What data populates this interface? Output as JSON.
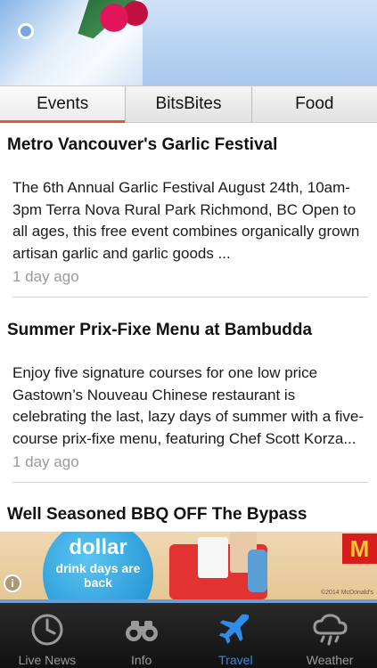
{
  "tabs": [
    {
      "label": "Events",
      "active": true
    },
    {
      "label": "BitsBites",
      "active": false
    },
    {
      "label": "Food",
      "active": false
    }
  ],
  "articles": [
    {
      "title": "Metro Vancouver's Garlic Festival",
      "body": "The 6th Annual Garlic Festival August 24th, 10am-3pm Terra Nova Rural Park Richmond, BC Open to all ages, this free event combines organically grown artisan garlic and garlic goods ...",
      "time": "1 day ago"
    },
    {
      "title": "Summer Prix-Fixe Menu at Bambudda",
      "body": "Enjoy five signature courses for one low price Gastown’s Nouveau Chinese restaurant is celebrating the last, lazy days of summer with a five-course prix-fixe menu, featuring Chef Scott Korza...",
      "time": "1 day ago"
    },
    {
      "title": "Well Seasoned BBQ OFF The Bypass"
    }
  ],
  "ad": {
    "headline": "dollar",
    "subline": "drink days are back",
    "brand_mark": "M",
    "legal": "©2014 McDonald's",
    "info_icon": "info-icon"
  },
  "tabbar": [
    {
      "label": "Live News",
      "icon": "clock-icon",
      "active": false
    },
    {
      "label": "Info",
      "icon": "binoculars-icon",
      "active": false
    },
    {
      "label": "Travel",
      "icon": "airplane-icon",
      "active": true
    },
    {
      "label": "Weather",
      "icon": "rain-cloud-icon",
      "active": false
    }
  ],
  "colors": {
    "active_tab_underline": "#e8552e",
    "tabbar_active": "#2d8de8",
    "tabbar_inactive": "#9a9a9a"
  }
}
